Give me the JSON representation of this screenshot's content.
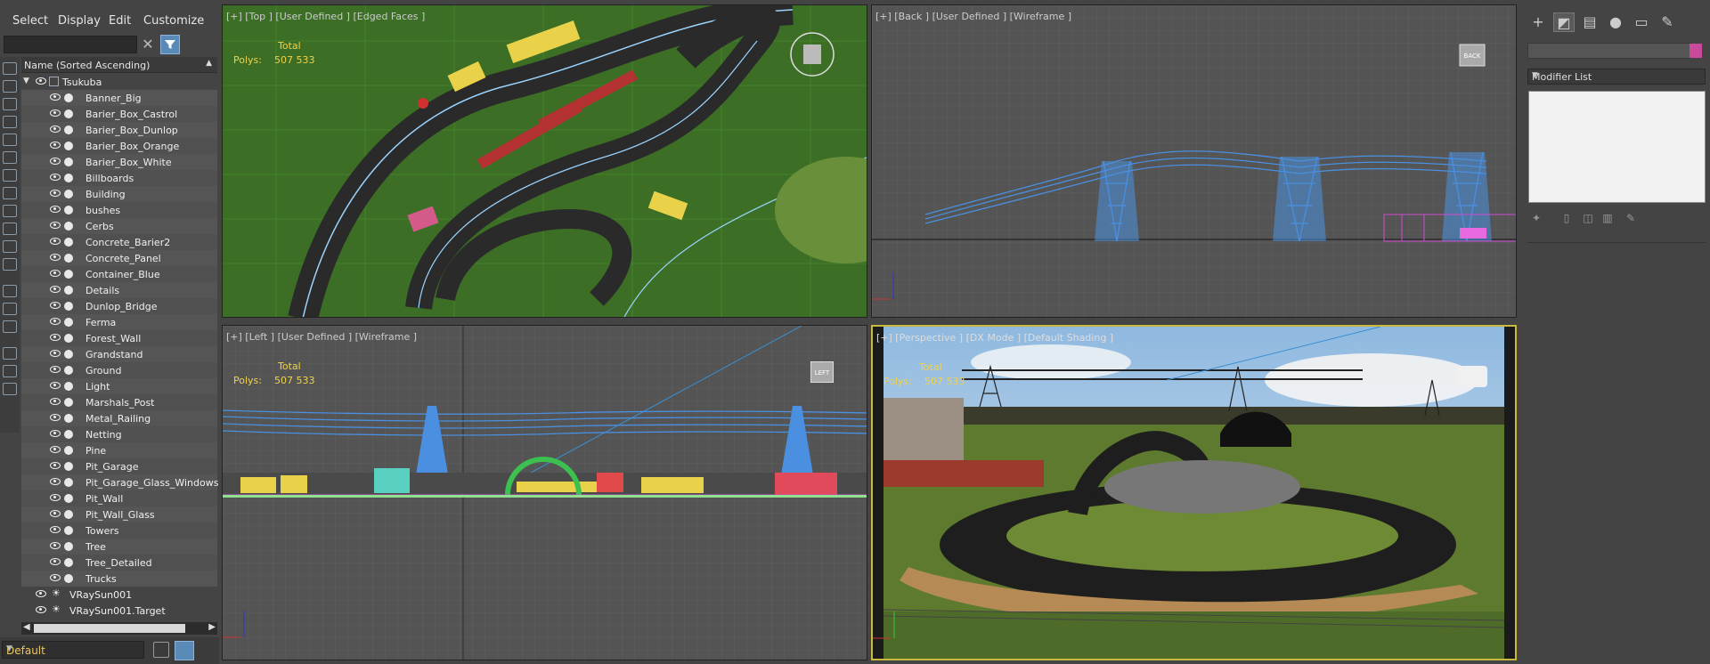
{
  "menu": {
    "select": "Select",
    "display": "Display",
    "edit": "Edit",
    "customize": "Customize"
  },
  "search": {
    "value": ""
  },
  "explorer": {
    "column_header": "Name (Sorted Ascending)",
    "root": "Tsukuba",
    "children": [
      "Banner_Big",
      "Barier_Box_Castrol",
      "Barier_Box_Dunlop",
      "Barier_Box_Orange",
      "Barier_Box_White",
      "Billboards",
      "Building",
      "bushes",
      "Cerbs",
      "Concrete_Barier2",
      "Concrete_Panel",
      "Container_Blue",
      "Details",
      "Dunlop_Bridge",
      "Ferma",
      "Forest_Wall",
      "Grandstand",
      "Ground",
      "Light",
      "Marshals_Post",
      "Metal_Railing",
      "Netting",
      "Pine",
      "Pit_Garage",
      "Pit_Garage_Glass_Windows",
      "Pit_Wall",
      "Pit_Wall_Glass",
      "Towers",
      "Tree",
      "Tree_Detailed",
      "Trucks"
    ],
    "lights": [
      "VRaySun001",
      "VRaySun001.Target"
    ]
  },
  "layer": {
    "current": "Default"
  },
  "viewports": {
    "top": {
      "label": "[+] [Top ] [User Defined ] [Edged Faces ]",
      "total_label": "Total",
      "polys_label": "Polys:",
      "polys_value": "507 533"
    },
    "back": {
      "label": "[+] [Back ] [User Defined ] [Wireframe ]",
      "cube_label": "BACK"
    },
    "left": {
      "label": "[+] [Left ] [User Defined ] [Wireframe ]",
      "total_label": "Total",
      "polys_label": "Polys:",
      "polys_value": "507 533",
      "cube_label": "LEFT"
    },
    "perspective": {
      "label": "[+] [Perspective ] [DX Mode ] [Default Shading ]",
      "total_label": "Total",
      "polys_label": "Polys:",
      "polys_value": "507 533"
    }
  },
  "command_panel": {
    "modifier_list": "Modifier List",
    "object_color": "#c94a9a"
  },
  "colors": {
    "wire_blue": "#4a8fe0",
    "grid": "#6a6a6a",
    "stats_yellow": "#f0d24a",
    "active_border": "#c9b93e"
  }
}
